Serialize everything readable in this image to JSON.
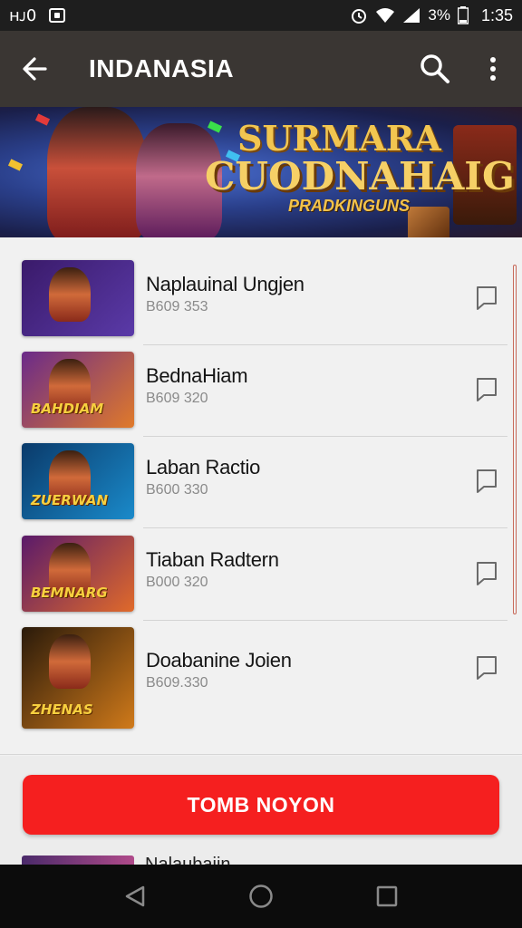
{
  "status_bar": {
    "left_text": "ʜᴊ0",
    "battery_text": "3%",
    "time": "1:35"
  },
  "app_bar": {
    "title": "INDANASIA",
    "icons": [
      "back-arrow-icon",
      "search-icon",
      "more-vert-icon"
    ]
  },
  "banner": {
    "title_line1": "SURMARA",
    "title_line2": "CUODNAHAIG",
    "subtitle": "PRADKINGUNS"
  },
  "items": [
    {
      "name": "Naplauinal Ungjen",
      "subtitle": "B609 353",
      "thumb_text": "",
      "colors": [
        "#3a1a6a",
        "#5a3aa8"
      ]
    },
    {
      "name": "BednaHiam",
      "subtitle": "B609 320",
      "thumb_text": "BAHDIAM",
      "colors": [
        "#6a2a8a",
        "#e07a2a"
      ]
    },
    {
      "name": "Laban Ractio",
      "subtitle": "B600 330",
      "thumb_text": "ZUERWAN",
      "colors": [
        "#0a3a6a",
        "#1a8aca"
      ]
    },
    {
      "name": "Tiaban Radtern",
      "subtitle": "B000 320",
      "thumb_text": "BEMNARG",
      "colors": [
        "#5a1a6a",
        "#e06a2a"
      ]
    },
    {
      "name": "Doabanine Joien",
      "subtitle": "B609.330",
      "thumb_text": "ZHENAS",
      "colors": [
        "#2a1a0a",
        "#d07a1a"
      ]
    }
  ],
  "cta": {
    "label": "TOMB NOYON"
  },
  "peek_item": {
    "name": "Nalaubaiin"
  },
  "nav_bar": {
    "icons": [
      "back-triangle-icon",
      "home-circle-icon",
      "recents-square-icon"
    ]
  }
}
